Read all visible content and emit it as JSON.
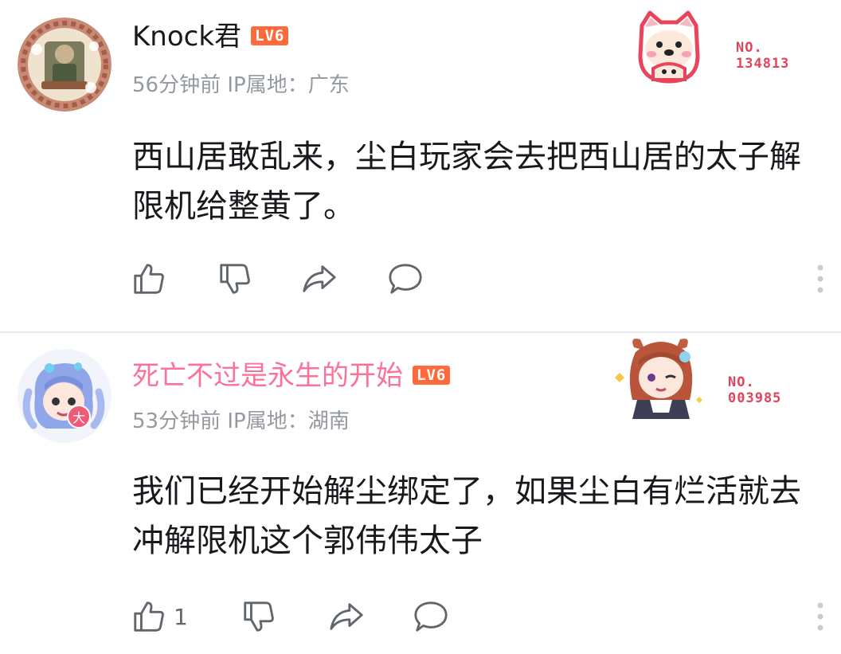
{
  "comments": [
    {
      "username": "Knock君",
      "level": "LV6",
      "time": "56分钟前",
      "ip": "IP属地：广东",
      "text": "西山居敢乱来，尘白玩家会去把西山居的太子解限机给整黄了。",
      "like_count": "",
      "badge_no_label": "NO.",
      "badge_no_value": "134813",
      "avatar_icon": "avatar-knock",
      "badge_icon": "dog-badge-icon"
    },
    {
      "username": "死亡不过是永生的开始",
      "level": "LV6",
      "time": "53分钟前",
      "ip": "IP属地：湖南",
      "text": "我们已经开始解尘绑定了，如果尘白有烂活就去冲解限机这个郭伟伟太子",
      "like_count": "1",
      "badge_no_label": "NO.",
      "badge_no_value": "003985",
      "avatar_icon": "avatar-anime-blue",
      "badge_icon": "anime-girl-badge-icon"
    }
  ],
  "colors": {
    "vip_name": "#fb7299",
    "level_badge": "#ff6a3d",
    "meta_gray": "#9499a0",
    "badge_number": "#e0445c"
  }
}
